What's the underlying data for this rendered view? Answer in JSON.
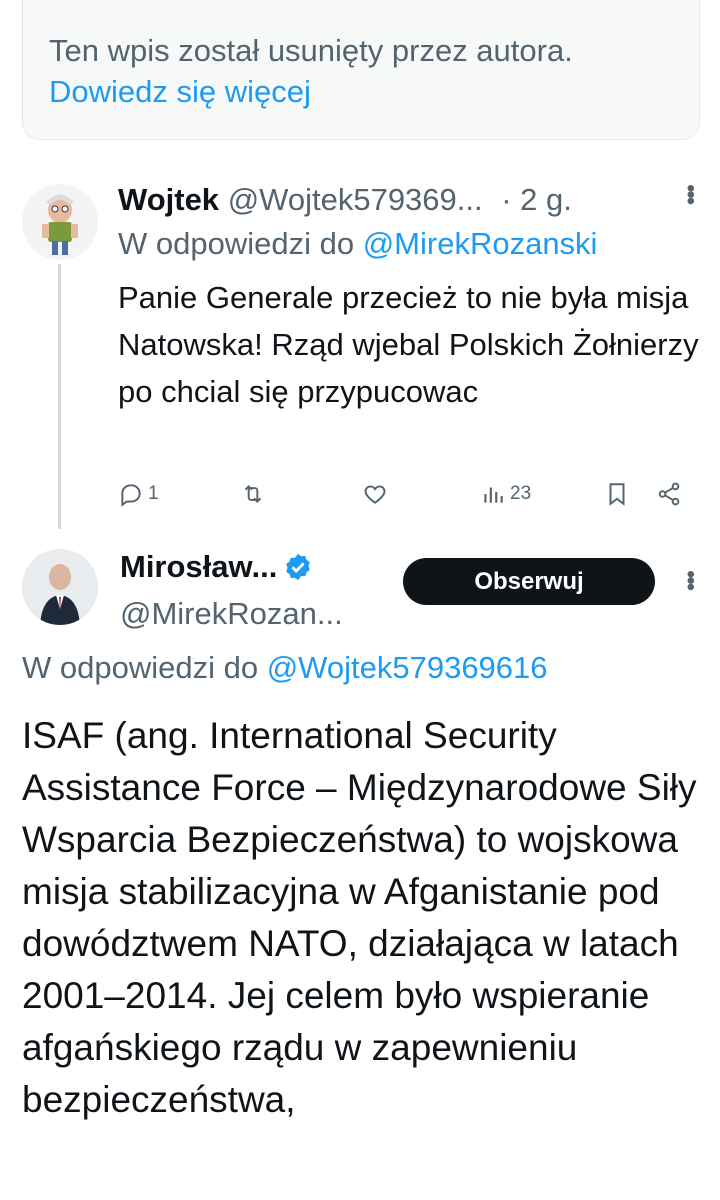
{
  "deleted_notice": {
    "text": "Ten wpis został usunięty przez autora.",
    "link": "Dowiedz się więcej"
  },
  "reply_tweet": {
    "name": "Wojtek",
    "handle": "@Wojtek579369...",
    "time": "· 2 g.",
    "reply_prefix": "W odpowiedzi do",
    "reply_handle": "@MirekRozanski",
    "text": "Panie  Generale przecież to nie była misja Natowska! Rząd  wjebal Polskich Żołnierzy  po chcial się przypucowac",
    "replies": "1",
    "views": "23"
  },
  "main_tweet": {
    "name": "Mirosław...",
    "handle": "@MirekRozan...",
    "follow_label": "Obserwuj",
    "reply_prefix": "W odpowiedzi do",
    "reply_handle": "@Wojtek579369616",
    "text": "ISAF (ang. International Security Assistance Force – Międzynarodowe Siły Wsparcia Bezpieczeństwa) to wojskowa misja stabilizacyjna w Afganistanie pod dowództwem NATO, działająca w latach 2001–2014. Jej celem było wspieranie afgańskiego rządu w zapewnieniu bezpieczeństwa,"
  },
  "colors": {
    "link": "#1d9bf0",
    "muted": "#536471",
    "text": "#0f1419"
  },
  "icons": [
    "reply-icon",
    "retweet-icon",
    "like-icon",
    "views-icon",
    "bookmark-icon",
    "share-icon",
    "more-icon",
    "verified-icon"
  ]
}
